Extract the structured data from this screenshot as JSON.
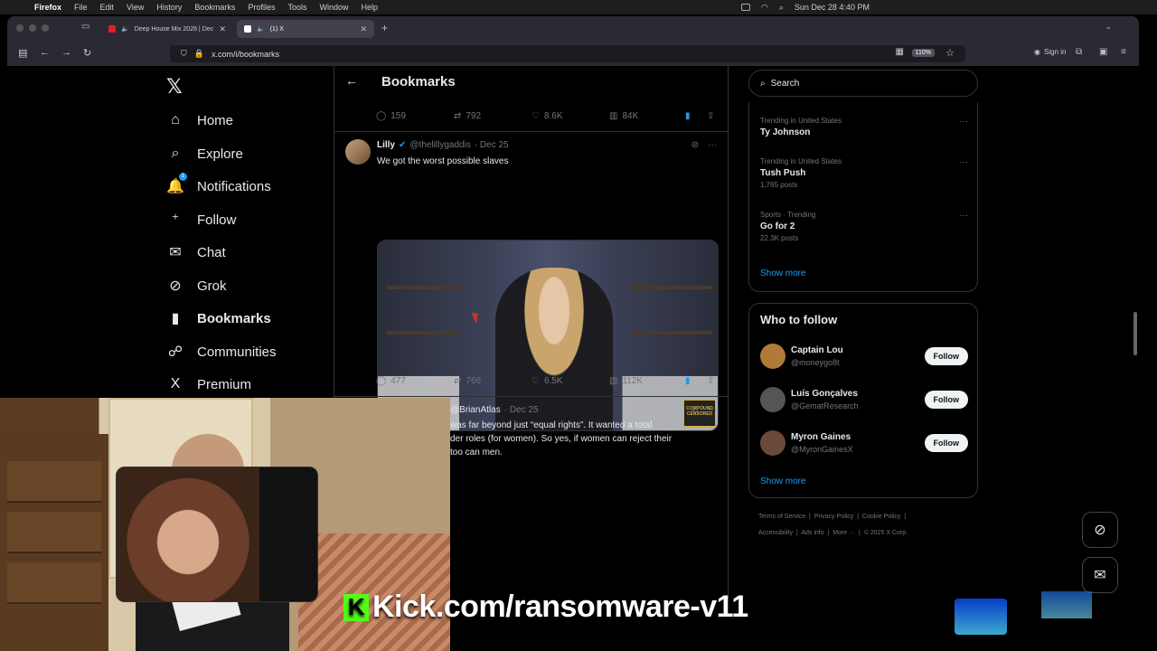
{
  "menubar": {
    "app": "Firefox",
    "items": [
      "File",
      "Edit",
      "View",
      "History",
      "Bookmarks",
      "Profiles",
      "Tools",
      "Window",
      "Help"
    ],
    "datetime": "Sun Dec 28  4:40 PM"
  },
  "browser": {
    "tabs": [
      {
        "title": "Deep House Mix 2026 | Dec",
        "active": false,
        "favicon_color": "#e32020"
      },
      {
        "title": "(1) X",
        "active": true,
        "favicon_color": "#ffffff"
      }
    ],
    "url": "x.com/i/bookmarks",
    "zoom": "110%",
    "signin_label": "Sign in"
  },
  "x": {
    "nav": [
      {
        "label": "Home",
        "icon": "home-icon",
        "glyph": "⌂"
      },
      {
        "label": "Explore",
        "icon": "search-icon",
        "glyph": "⌕"
      },
      {
        "label": "Notifications",
        "icon": "bell-icon",
        "glyph": "🔔",
        "badge": "1"
      },
      {
        "label": "Follow",
        "icon": "follow-icon",
        "glyph": "⁺"
      },
      {
        "label": "Chat",
        "icon": "mail-icon",
        "glyph": "✉"
      },
      {
        "label": "Grok",
        "icon": "grok-icon",
        "glyph": "⊘"
      },
      {
        "label": "Bookmarks",
        "icon": "bookmark-icon",
        "glyph": "▮",
        "active": true
      },
      {
        "label": "Communities",
        "icon": "communities-icon",
        "glyph": "☍"
      },
      {
        "label": "Premium",
        "icon": "x-logo-icon",
        "glyph": "X"
      }
    ],
    "header_title": "Bookmarks",
    "top_post_actions": {
      "replies": "159",
      "reposts": "792",
      "likes": "8.6K",
      "views": "84K"
    },
    "post1": {
      "name": "Lilly",
      "handle": "@thelillygaddis",
      "date": "· Dec 25",
      "text": "We got the worst possible slaves",
      "media_badge": "COMPOUND CENSORED",
      "actions": {
        "replies": "477",
        "reposts": "766",
        "likes": "6.5K",
        "views": "112K"
      }
    },
    "post2": {
      "handle": "@BrianAtlas",
      "date": "· Dec 25",
      "text_lines": [
        "was far beyond just “equal rights”. It wanted a total",
        "der roles (for women). So yes, if women can reject their",
        "too can men."
      ]
    },
    "search_placeholder": "Search",
    "trends": [
      {
        "context": "Trending in United States",
        "title": "Ty Johnson",
        "posts": ""
      },
      {
        "context": "Trending in United States",
        "title": "Tush Push",
        "posts": "1,765 posts"
      },
      {
        "context": "Sports · Trending",
        "title": "Go for 2",
        "posts": "22.3K posts"
      }
    ],
    "trends_show_more": "Show more",
    "who_to_follow_title": "Who to follow",
    "who_to_follow": [
      {
        "name": "Captain Lou",
        "handle": "@moneygo8t",
        "button": "Follow",
        "color": "#b07a3a"
      },
      {
        "name": "Luís Gonçalves",
        "handle": "@GematResearch",
        "button": "Follow",
        "color": "#555555"
      },
      {
        "name": "Myron Gaines",
        "handle": "@MyronGainesX",
        "button": "Follow",
        "color": "#6b4a3a"
      }
    ],
    "wtf_show_more": "Show more",
    "footer_line1": [
      "Terms of Service",
      "Privacy Policy",
      "Cookie Policy"
    ],
    "footer_line2": [
      "Accessibility",
      "Ads info",
      "More ···",
      "© 2025 X Corp."
    ]
  },
  "overlay": {
    "kick_text": "Kick.com/ransomware-v11",
    "kick_logo": "K"
  }
}
